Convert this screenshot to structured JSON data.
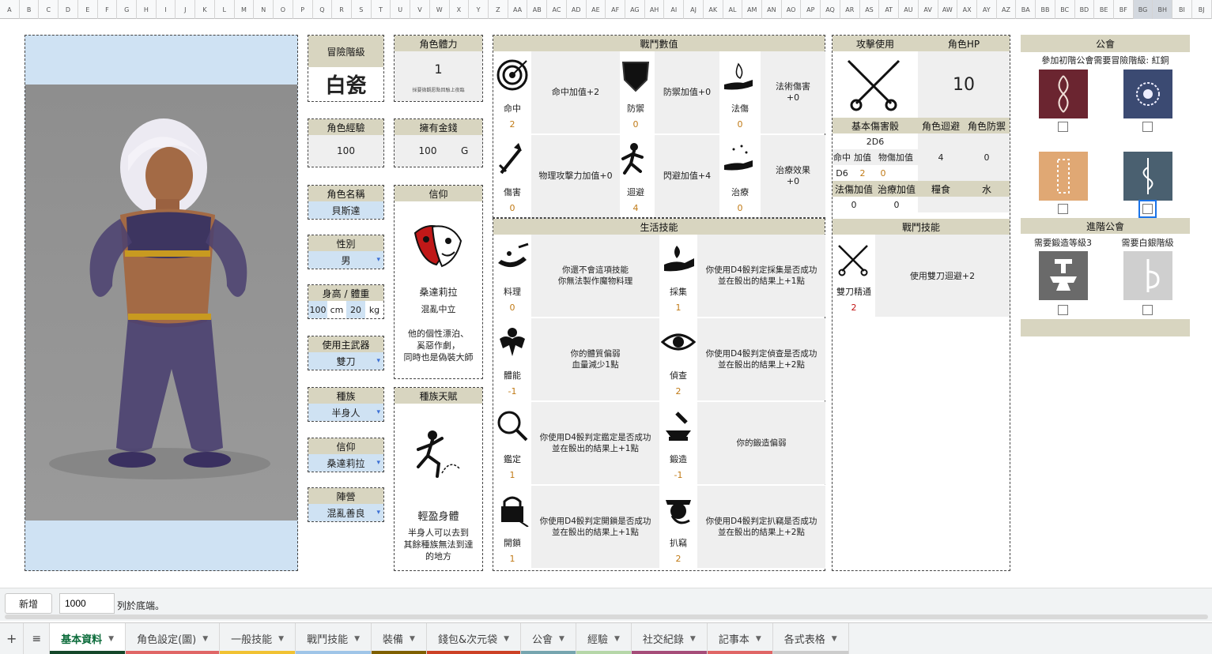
{
  "columns": [
    "A",
    "B",
    "C",
    "D",
    "E",
    "F",
    "G",
    "H",
    "I",
    "J",
    "K",
    "L",
    "M",
    "N",
    "O",
    "P",
    "Q",
    "R",
    "S",
    "T",
    "U",
    "V",
    "W",
    "X",
    "Y",
    "Z",
    "AA",
    "AB",
    "AC",
    "AD",
    "AE",
    "AF",
    "AG",
    "AH",
    "AI",
    "AJ",
    "AK",
    "AL",
    "AM",
    "AN",
    "AO",
    "AP",
    "AQ",
    "AR",
    "AS",
    "AT",
    "AU",
    "AV",
    "AW",
    "AX",
    "AY",
    "AZ",
    "BA",
    "BB",
    "BC",
    "BD",
    "BE",
    "BF",
    "BG",
    "BH",
    "BI",
    "BJ"
  ],
  "info": {
    "rank_label": "冒險階級",
    "rank_value": "白瓷",
    "stamina_label": "角色體力",
    "stamina_value": "1",
    "stamina_note": "採要微觀愿點回驗上夜臨",
    "exp_label": "角色經驗",
    "exp_value": "100",
    "gold_label": "擁有金錢",
    "gold_value": "100",
    "gold_unit": "G",
    "name_label": "角色名稱",
    "name_value": "貝斯達",
    "faith_label": "信仰",
    "faith_god": "桑達莉拉",
    "faith_align": "混亂中立",
    "faith_desc": "他的個性漂泊、\n奚惡作劇，\n同時也是偽裝大師",
    "gender_label": "性別",
    "gender_value": "男",
    "hw_label": "身高 / 體重",
    "height": "100",
    "height_unit": "cm",
    "weight": "20",
    "weight_unit": "kg",
    "weapon_label": "使用主武器",
    "weapon_value": "雙刀",
    "race_label": "種族",
    "race_value": "半身人",
    "race_talent_label": "種族天賦",
    "talent_name": "輕盈身體",
    "talent_desc": "半身人可以去到\n其餘種族無法到達\n的地方",
    "faith2_label": "信仰",
    "faith2_value": "桑達莉拉",
    "camp_label": "陣營",
    "camp_value": "混亂善良"
  },
  "combat": {
    "title": "戰鬥數值",
    "stats": [
      {
        "name": "命中",
        "value": "2",
        "bonus": "命中加值+2",
        "icon": "target-icon"
      },
      {
        "name": "防禦",
        "value": "0",
        "bonus": "防禦加值+0",
        "icon": "shield-icon"
      },
      {
        "name": "法傷",
        "value": "0",
        "bonus": "法術傷害\n+0",
        "icon": "magic-hand-icon"
      },
      {
        "name": "傷害",
        "value": "0",
        "bonus": "物理攻擊力加值+0",
        "icon": "sword-up-icon"
      },
      {
        "name": "迴避",
        "value": "4",
        "bonus": "閃避加值+4",
        "icon": "dodge-icon"
      },
      {
        "name": "治療",
        "value": "0",
        "bonus": "治療效果\n+0",
        "icon": "heal-hand-icon"
      }
    ]
  },
  "life": {
    "title": "生活技能",
    "skills": [
      {
        "name": "料理",
        "value": "0",
        "desc": "你還不會這項技能\n你無法製作魔物料理",
        "icon": "cooking-icon"
      },
      {
        "name": "採集",
        "value": "1",
        "desc": "你使用D4骰判定採集是否成功\n並在骰出的結果上+1點",
        "icon": "gather-icon"
      },
      {
        "name": "體能",
        "value": "-1",
        "desc": "你的體質偏弱\n血量減少1點",
        "icon": "muscle-icon"
      },
      {
        "name": "偵查",
        "value": "2",
        "desc": "你使用D4骰判定偵查是否成功\n並在骰出的結果上+2點",
        "icon": "eye-icon"
      },
      {
        "name": "鑑定",
        "value": "1",
        "desc": "你使用D4骰判定鑑定是否成功\n並在骰出的結果上+1點",
        "icon": "magnifier-icon"
      },
      {
        "name": "鍛造",
        "value": "-1",
        "desc": "你的鍛造偏弱",
        "icon": "forge-icon"
      },
      {
        "name": "開鎖",
        "value": "1",
        "desc": "你使用D4骰判定開鎖是否成功\n並在骰出的結果上+1點",
        "icon": "lock-icon"
      },
      {
        "name": "扒竊",
        "value": "2",
        "desc": "你使用D4骰判定扒竊是否成功\n並在骰出的結果上+2點",
        "icon": "thief-icon"
      }
    ]
  },
  "attack": {
    "use_label": "攻擊使用",
    "hp_label": "角色HP",
    "hp_value": "10",
    "base_dmg_label": "基本傷害骰",
    "base_dmg_value": "2D6",
    "evade_label": "角色迴避",
    "evade_value": "4",
    "def_label": "角色防禦",
    "def_value": "0",
    "hit_label": "命中",
    "hit_bonus_label": "加值",
    "phys_bonus_label": "物傷加值",
    "dice": "D6",
    "hit_bonus": "2",
    "phys_bonus": "0",
    "magic_bonus_label": "法傷加值",
    "heal_bonus_label": "治療加值",
    "magic_bonus": "0",
    "heal_bonus": "0",
    "food_label": "糧食",
    "water_label": "水",
    "combat_skill_title": "戰鬥技能",
    "combat_skill_name": "雙刀精通",
    "combat_skill_value": "2",
    "combat_skill_desc": "使用雙刀迴避+2"
  },
  "guild": {
    "title": "公會",
    "req": "參加初階公會需要冒險階級: 紅銅",
    "advanced_title": "進階公會",
    "adv_req1": "需要鍛造等級3",
    "adv_req2": "需要白銀階級",
    "emblem_colors": [
      "#6b2530",
      "#3b4a72",
      "#e0a874",
      "#4a6070"
    ]
  },
  "bottom": {
    "add_button": "新增",
    "rows_value": "1000",
    "rows_suffix": "列於底端。"
  },
  "tabs": [
    {
      "label": "基本資料",
      "color": "#14472a"
    },
    {
      "label": "角色設定(圖)",
      "color": "#e06666"
    },
    {
      "label": "一般技能",
      "color": "#f1c232"
    },
    {
      "label": "戰鬥技能",
      "color": "#9fc5e8"
    },
    {
      "label": "裝備",
      "color": "#7f6000"
    },
    {
      "label": "錢包&次元袋",
      "color": "#cc4125"
    },
    {
      "label": "公會",
      "color": "#76a5af"
    },
    {
      "label": "經驗",
      "color": "#b6d7a8"
    },
    {
      "label": "社交紀錄",
      "color": "#a64d79"
    },
    {
      "label": "記事本",
      "color": "#e06666"
    },
    {
      "label": "各式表格",
      "color": "#cccccc"
    }
  ]
}
